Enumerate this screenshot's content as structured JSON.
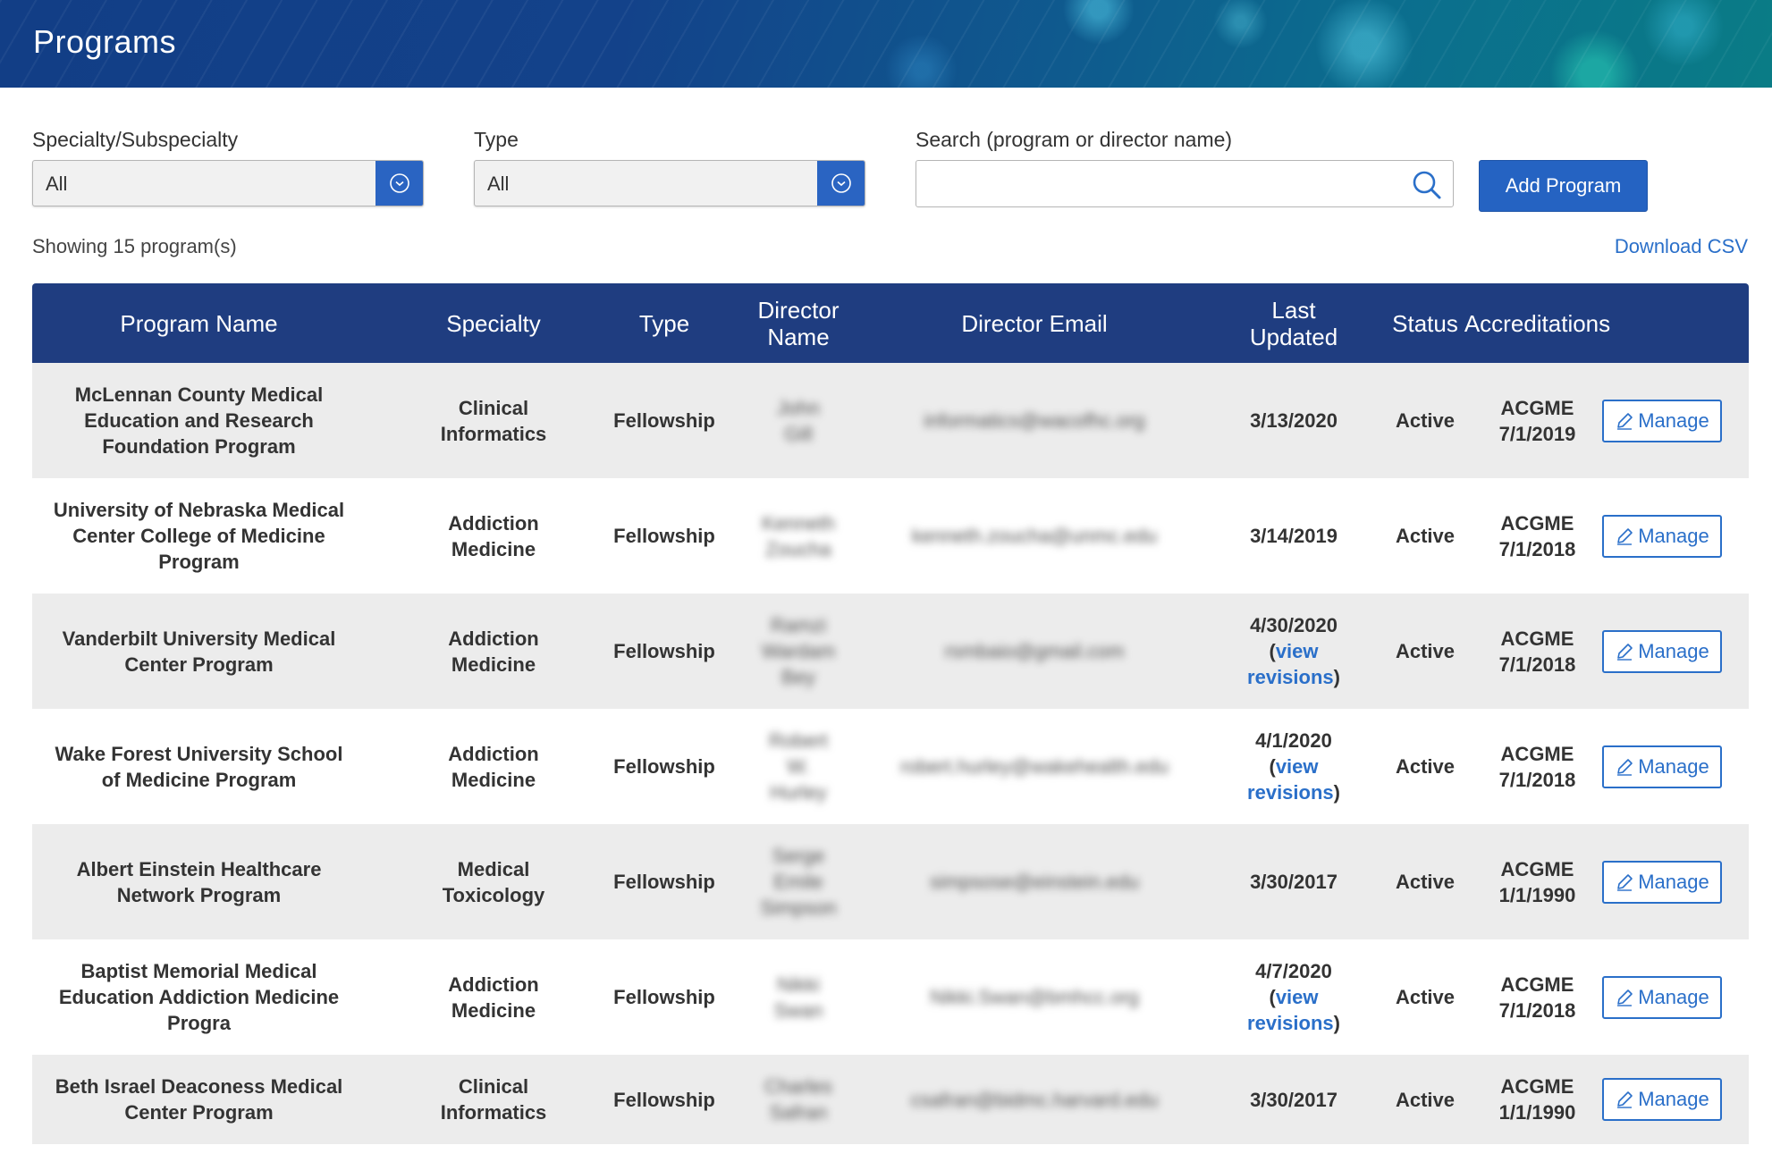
{
  "header": {
    "title": "Programs"
  },
  "filters": {
    "specialty": {
      "label": "Specialty/Subspecialty",
      "value": "All"
    },
    "type": {
      "label": "Type",
      "value": "All"
    },
    "search": {
      "label": "Search (program or director name)",
      "placeholder": "",
      "value": ""
    },
    "add_button": "Add Program"
  },
  "summary": {
    "showing": "Showing 15 program(s)",
    "download": "Download CSV"
  },
  "table": {
    "columns": {
      "name": "Program Name",
      "specialty": "Specialty",
      "type": "Type",
      "director_name": "Director Name",
      "director_email": "Director Email",
      "last_updated": "Last Updated",
      "status": "Status",
      "accreditations": "Accreditations"
    },
    "manage_label": "Manage",
    "view_label": "view",
    "revisions_label": "revisions",
    "rows": [
      {
        "name": "McLennan County Medical Education and Research Foundation Program",
        "specialty": "Clinical Informatics",
        "type": "Fellowship",
        "director": "John Gill",
        "email": "informatics@wacofhc.org",
        "updated": "3/13/2020",
        "has_revisions": false,
        "status": "Active",
        "acc_body": "ACGME",
        "acc_date": "7/1/2019"
      },
      {
        "name": "University of Nebraska Medical Center College of Medicine Program",
        "specialty": "Addiction Medicine",
        "type": "Fellowship",
        "director": "Kenneth Zoucha",
        "email": "kenneth.zoucha@unmc.edu",
        "updated": "3/14/2019",
        "has_revisions": false,
        "status": "Active",
        "acc_body": "ACGME",
        "acc_date": "7/1/2018"
      },
      {
        "name": "Vanderbilt University Medical Center Program",
        "specialty": "Addiction Medicine",
        "type": "Fellowship",
        "director": "Ramzi Wardam Bey",
        "email": "rsmbaio@gmail.com",
        "updated": "4/30/2020",
        "has_revisions": true,
        "status": "Active",
        "acc_body": "ACGME",
        "acc_date": "7/1/2018"
      },
      {
        "name": "Wake Forest University School of Medicine Program",
        "specialty": "Addiction Medicine",
        "type": "Fellowship",
        "director": "Robert W. Hurley",
        "email": "robert.hurley@wakehealth.edu",
        "updated": "4/1/2020",
        "has_revisions": true,
        "status": "Active",
        "acc_body": "ACGME",
        "acc_date": "7/1/2018"
      },
      {
        "name": "Albert Einstein Healthcare Network Program",
        "specialty": "Medical Toxicology",
        "type": "Fellowship",
        "director": "Serge Emile Simpson",
        "email": "simpsose@einstein.edu",
        "updated": "3/30/2017",
        "has_revisions": false,
        "status": "Active",
        "acc_body": "ACGME",
        "acc_date": "1/1/1990"
      },
      {
        "name": "Baptist Memorial Medical Education Addiction Medicine Progra",
        "specialty": "Addiction Medicine",
        "type": "Fellowship",
        "director": "Nikki Swan",
        "email": "Nikki.Swan@bmhcc.org",
        "updated": "4/7/2020",
        "has_revisions": true,
        "status": "Active",
        "acc_body": "ACGME",
        "acc_date": "7/1/2018"
      },
      {
        "name": "Beth Israel Deaconess Medical Center Program",
        "specialty": "Clinical Informatics",
        "type": "Fellowship",
        "director": "Charles Safran",
        "email": "csafran@bidmc.harvard.edu",
        "updated": "3/30/2017",
        "has_revisions": false,
        "status": "Active",
        "acc_body": "ACGME",
        "acc_date": "1/1/1990"
      }
    ]
  },
  "colors": {
    "header_bg": "#1f3d80",
    "accent": "#2563c2",
    "link": "#2a6fc9",
    "row_alt": "#ececec"
  }
}
